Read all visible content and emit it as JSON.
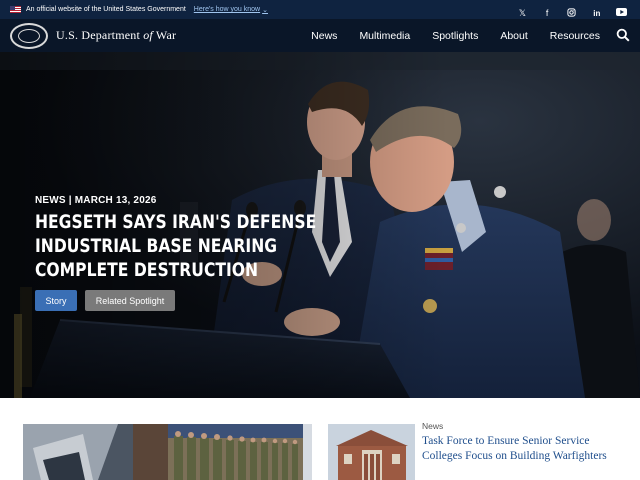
{
  "gov_banner": {
    "official_text": "An official website of the United States Government",
    "link_text": "Here's how you know",
    "link_icon": "chevron-down-icon"
  },
  "social": {
    "items": [
      {
        "name": "x-icon",
        "glyph": "𝕏"
      },
      {
        "name": "facebook-icon",
        "glyph": "f"
      },
      {
        "name": "instagram-icon",
        "glyph": "◎"
      },
      {
        "name": "linkedin-icon",
        "glyph": "in"
      },
      {
        "name": "youtube-icon",
        "glyph": "▶"
      }
    ]
  },
  "header": {
    "title_before": "U.S. Department ",
    "title_italic": "of",
    "title_after": " War",
    "nav": [
      "News",
      "Multimedia",
      "Spotlights",
      "About",
      "Resources"
    ],
    "search_icon": "search-icon"
  },
  "hero": {
    "meta": "NEWS | MARCH 13, 2026",
    "title_lines": [
      "HEGSETH SAYS IRAN'S DEFENSE",
      "INDUSTRIAL BASE NEARING",
      "COMPLETE DESTRUCTION"
    ],
    "story_button": "Story",
    "related_button": "Related Spotlight"
  },
  "news_strip": {
    "card_category": "News",
    "card_title": "Task Force to Ensure Senior Service Colleges Focus on Building Warfighters"
  },
  "colors": {
    "banner_bg": "#0f2340",
    "header_bg": "#0a1628",
    "story_button": "#3a6fb5",
    "related_button": "#7a7a7a",
    "link_blue": "#1f4e8c"
  }
}
